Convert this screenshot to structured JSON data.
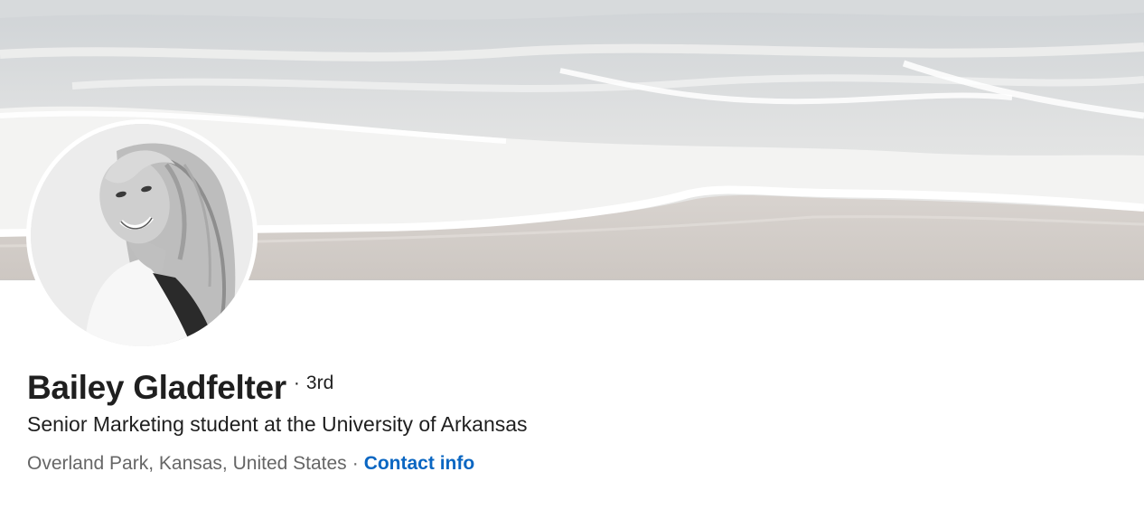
{
  "profile": {
    "name": "Bailey Gladfelter",
    "degree_separator": "·",
    "degree": "3rd",
    "headline": "Senior Marketing student at the University of Arkansas",
    "location": "Overland Park, Kansas, United States",
    "location_separator": "·",
    "contact_link": "Contact info"
  },
  "colors": {
    "link": "#0a66c2",
    "primary_text": "#1f1f1f",
    "secondary_text": "#666666"
  }
}
